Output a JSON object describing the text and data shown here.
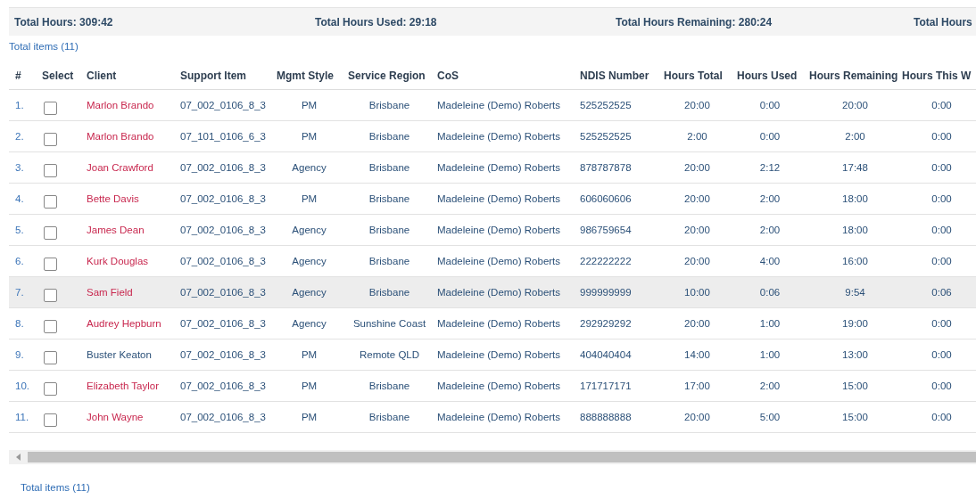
{
  "summary": [
    {
      "label": "Total Hours: 309:42"
    },
    {
      "label": "Total Hours Used: 29:18"
    },
    {
      "label": "Total Hours Remaining: 280:24"
    },
    {
      "label": "Total Hours"
    }
  ],
  "total_items_top": "Total items (11)",
  "table": {
    "columns": [
      "#",
      "Select",
      "Client",
      "Support Item",
      "Mgmt Style",
      "Service Region",
      "CoS",
      "NDIS Number",
      "Hours Total",
      "Hours Used",
      "Hours Remaining",
      "Hours This W"
    ],
    "rows": [
      {
        "index": "1.",
        "checked": false,
        "highlighted": false,
        "client": "Marlon Brando",
        "color": "#c8274e",
        "support_item": "07_002_0106_8_3",
        "mgmt_style": "PM",
        "region": "Brisbane",
        "cos": "Madeleine (Demo) Roberts",
        "ndis": "525252525",
        "hours_total": "20:00",
        "hours_used": "0:00",
        "hours_remaining": "20:00",
        "hours_this_week": "0:00"
      },
      {
        "index": "2.",
        "checked": false,
        "highlighted": false,
        "client": "Marlon Brando",
        "color": "#c8274e",
        "support_item": "07_101_0106_6_3",
        "mgmt_style": "PM",
        "region": "Brisbane",
        "cos": "Madeleine (Demo) Roberts",
        "ndis": "525252525",
        "hours_total": "2:00",
        "hours_used": "0:00",
        "hours_remaining": "2:00",
        "hours_this_week": "0:00"
      },
      {
        "index": "3.",
        "checked": false,
        "highlighted": false,
        "client": "Joan Crawford",
        "color": "#c8274e",
        "support_item": "07_002_0106_8_3",
        "mgmt_style": "Agency",
        "region": "Brisbane",
        "cos": "Madeleine (Demo) Roberts",
        "ndis": "878787878",
        "hours_total": "20:00",
        "hours_used": "2:12",
        "hours_remaining": "17:48",
        "hours_this_week": "0:00"
      },
      {
        "index": "4.",
        "checked": false,
        "highlighted": false,
        "client": "Bette Davis",
        "color": "#c8274e",
        "support_item": "07_002_0106_8_3",
        "mgmt_style": "PM",
        "region": "Brisbane",
        "cos": "Madeleine (Demo) Roberts",
        "ndis": "606060606",
        "hours_total": "20:00",
        "hours_used": "2:00",
        "hours_remaining": "18:00",
        "hours_this_week": "0:00"
      },
      {
        "index": "5.",
        "checked": false,
        "highlighted": false,
        "client": "James Dean",
        "color": "#c8274e",
        "support_item": "07_002_0106_8_3",
        "mgmt_style": "Agency",
        "region": "Brisbane",
        "cos": "Madeleine (Demo) Roberts",
        "ndis": "986759654",
        "hours_total": "20:00",
        "hours_used": "2:00",
        "hours_remaining": "18:00",
        "hours_this_week": "0:00"
      },
      {
        "index": "6.",
        "checked": false,
        "highlighted": false,
        "client": "Kurk Douglas",
        "color": "#c8274e",
        "support_item": "07_002_0106_8_3",
        "mgmt_style": "Agency",
        "region": "Brisbane",
        "cos": "Madeleine (Demo) Roberts",
        "ndis": "222222222",
        "hours_total": "20:00",
        "hours_used": "4:00",
        "hours_remaining": "16:00",
        "hours_this_week": "0:00"
      },
      {
        "index": "7.",
        "checked": false,
        "highlighted": true,
        "client": "Sam Field",
        "color": "#c8274e",
        "support_item": "07_002_0106_8_3",
        "mgmt_style": "Agency",
        "region": "Brisbane",
        "cos": "Madeleine (Demo) Roberts",
        "ndis": "999999999",
        "hours_total": "10:00",
        "hours_used": "0:06",
        "hours_remaining": "9:54",
        "hours_this_week": "0:06"
      },
      {
        "index": "8.",
        "checked": false,
        "highlighted": false,
        "client": "Audrey Hepburn",
        "color": "#c8274e",
        "support_item": "07_002_0106_8_3",
        "mgmt_style": "Agency",
        "region": "Sunshine Coast",
        "cos": "Madeleine (Demo) Roberts",
        "ndis": "292929292",
        "hours_total": "20:00",
        "hours_used": "1:00",
        "hours_remaining": "19:00",
        "hours_this_week": "0:00"
      },
      {
        "index": "9.",
        "checked": false,
        "highlighted": false,
        "client": "Buster Keaton",
        "color": "#2b5078",
        "support_item": "07_002_0106_8_3",
        "mgmt_style": "PM",
        "region": "Remote QLD",
        "cos": "Madeleine (Demo) Roberts",
        "ndis": "404040404",
        "hours_total": "14:00",
        "hours_used": "1:00",
        "hours_remaining": "13:00",
        "hours_this_week": "0:00"
      },
      {
        "index": "10.",
        "checked": false,
        "highlighted": false,
        "client": "Elizabeth Taylor",
        "color": "#c8274e",
        "support_item": "07_002_0106_8_3",
        "mgmt_style": "PM",
        "region": "Brisbane",
        "cos": "Madeleine (Demo) Roberts",
        "ndis": "171717171",
        "hours_total": "17:00",
        "hours_used": "2:00",
        "hours_remaining": "15:00",
        "hours_this_week": "0:00"
      },
      {
        "index": "11.",
        "checked": false,
        "highlighted": false,
        "client": "John Wayne",
        "color": "#c8274e",
        "support_item": "07_002_0106_8_3",
        "mgmt_style": "PM",
        "region": "Brisbane",
        "cos": "Madeleine (Demo) Roberts",
        "ndis": "888888888",
        "hours_total": "20:00",
        "hours_used": "5:00",
        "hours_remaining": "15:00",
        "hours_this_week": "0:00"
      }
    ]
  },
  "total_items_bottom": "Total items (11)"
}
